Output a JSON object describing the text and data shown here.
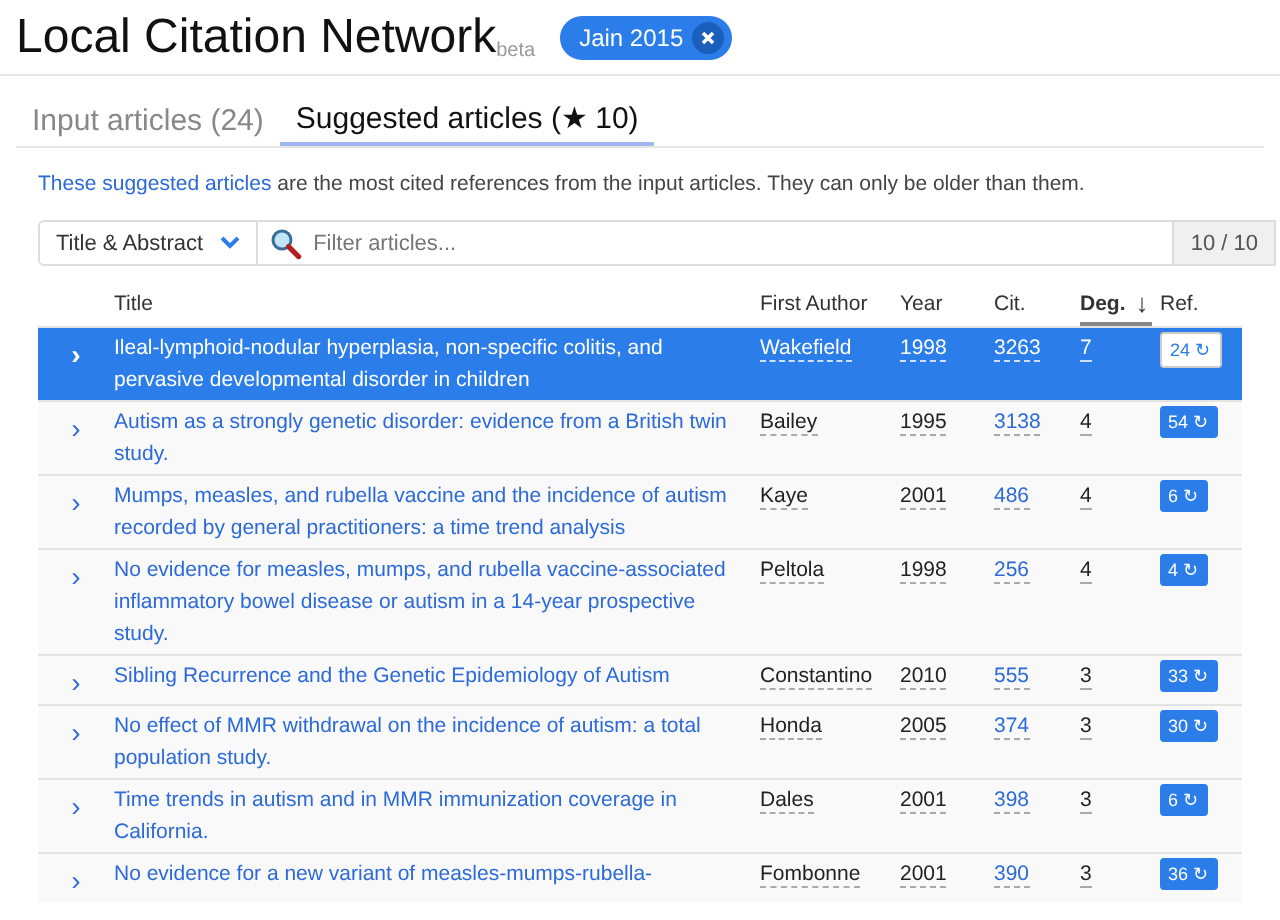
{
  "app": {
    "title": "Local Citation Network",
    "badge": "beta",
    "filter_chip": "Jain 2015"
  },
  "tabs": [
    {
      "label": "Input articles (24)",
      "selected": false
    },
    {
      "label": "Suggested articles (★ 10)",
      "selected": true
    }
  ],
  "intro": {
    "link": "These suggested articles",
    "text": "are the most cited references from the input articles. They can only be older than them."
  },
  "filter": {
    "field": "Title & Abstract",
    "placeholder": "Filter articles...",
    "count": "10 / 10"
  },
  "table": {
    "columns": [
      {
        "label": "Title",
        "sorted": false
      },
      {
        "label": "First Author",
        "sorted": false
      },
      {
        "label": "Year",
        "sorted": false
      },
      {
        "label": "Cit.",
        "sorted": false
      },
      {
        "label": "Deg.",
        "sorted": true
      },
      {
        "label": "Ref.",
        "sorted": false
      }
    ],
    "sort_arrow": "↓",
    "expand_icon": "›",
    "rows": [
      {
        "title": "Ileal-lymphoid-nodular hyperplasia, non-specific colitis, and pervasive developmental disorder in children",
        "author": "Wakefield",
        "year": "1998",
        "citations": "3263",
        "degree": "7",
        "refs": "24 ↻",
        "selected": true
      },
      {
        "title": "Autism as a strongly genetic disorder: evidence from a British twin study.",
        "author": "Bailey",
        "year": "1995",
        "citations": "3138",
        "degree": "4",
        "refs": "54 ↻",
        "selected": false
      },
      {
        "title": "Mumps, measles, and rubella vaccine and the incidence of autism recorded by general practitioners: a time trend analysis",
        "author": "Kaye",
        "year": "2001",
        "citations": "486",
        "degree": "4",
        "refs": "6 ↻",
        "selected": false
      },
      {
        "title": "No evidence for measles, mumps, and rubella vaccine-associated inflammatory bowel disease or autism in a 14-year prospective study.",
        "author": "Peltola",
        "year": "1998",
        "citations": "256",
        "degree": "4",
        "refs": "4 ↻",
        "selected": false
      },
      {
        "title": "Sibling Recurrence and the Genetic Epidemiology of Autism",
        "author": "Constantino",
        "year": "2010",
        "citations": "555",
        "degree": "3",
        "refs": "33 ↻",
        "selected": false
      },
      {
        "title": "No effect of MMR withdrawal on the incidence of autism: a total population study.",
        "author": "Honda",
        "year": "2005",
        "citations": "374",
        "degree": "3",
        "refs": "30 ↻",
        "selected": false
      },
      {
        "title": "Time trends in autism and in MMR immunization coverage in California.",
        "author": "Dales",
        "year": "2001",
        "citations": "398",
        "degree": "3",
        "refs": "6 ↻",
        "selected": false
      },
      {
        "title": "No evidence for a new variant of measles-mumps-rubella-",
        "author": "Fombonne",
        "year": "2001",
        "citations": "390",
        "degree": "3",
        "refs": "36 ↻",
        "selected": false
      }
    ]
  }
}
